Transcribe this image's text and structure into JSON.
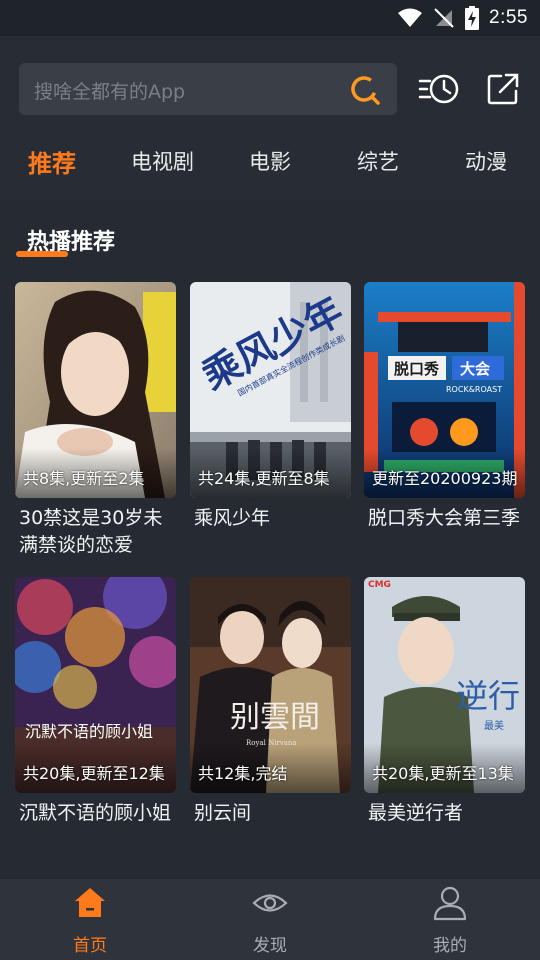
{
  "status_bar": {
    "time": "2:55"
  },
  "search": {
    "placeholder": "搜啥全都有的App"
  },
  "tabs": [
    {
      "label": "推荐",
      "active": true
    },
    {
      "label": "电视剧"
    },
    {
      "label": "电影"
    },
    {
      "label": "综艺"
    },
    {
      "label": "动漫"
    }
  ],
  "section": {
    "title": "热播推荐"
  },
  "cards": [
    {
      "badge": "共8集,更新至2集",
      "title": "30禁这是30岁未满禁谈的恋爱"
    },
    {
      "badge": "共24集,更新至8集",
      "title": "乘风少年",
      "poster_text": "乘风少年",
      "poster_subtext": "国内首部真实全流程创作类成长剧"
    },
    {
      "badge": "更新至20200923期",
      "title": "脱口秀大会第三季",
      "poster_text": "脱口秀",
      "poster_text2": "大会",
      "poster_subtext": "ROCK&ROAST"
    },
    {
      "badge": "共20集,更新至12集",
      "title": "沉默不语的顾小姐",
      "poster_text": "沉默不语的顾小姐"
    },
    {
      "badge": "共12集,完结",
      "title": "别云间",
      "poster_text": "别雲間",
      "poster_subtext": "Royal Nirvana"
    },
    {
      "badge": "共20集,更新至13集",
      "title": "最美逆行者",
      "poster_text": "逆行",
      "poster_subtext": "最美",
      "poster_logo": "CMG"
    }
  ],
  "bottom_nav": [
    {
      "label": "首页",
      "icon": "home-icon",
      "active": true
    },
    {
      "label": "发现",
      "icon": "eye-icon"
    },
    {
      "label": "我的",
      "icon": "user-icon"
    }
  ],
  "colors": {
    "accent": "#ff7a1a",
    "background": "#262b33",
    "bar": "#2f343c"
  }
}
